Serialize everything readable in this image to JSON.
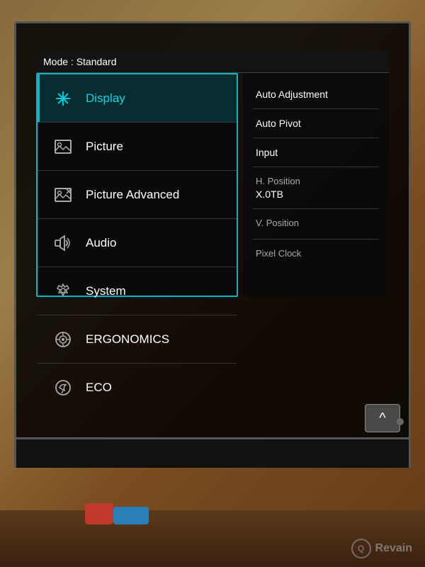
{
  "mode": {
    "label": "Mode : Standard"
  },
  "menu": {
    "items": [
      {
        "id": "display",
        "label": "Display",
        "active": true,
        "icon": "display-icon"
      },
      {
        "id": "picture",
        "label": "Picture",
        "active": false,
        "icon": "picture-icon"
      },
      {
        "id": "picture-advanced",
        "label": "Picture Advanced",
        "active": false,
        "icon": "picture-advanced-icon"
      },
      {
        "id": "audio",
        "label": "Audio",
        "active": false,
        "icon": "audio-icon"
      },
      {
        "id": "system",
        "label": "System",
        "active": false,
        "icon": "system-icon"
      },
      {
        "id": "ergonomics",
        "label": "ERGONOMICS",
        "active": false,
        "icon": "ergonomics-icon"
      },
      {
        "id": "eco",
        "label": "ECO",
        "active": false,
        "icon": "eco-icon"
      }
    ]
  },
  "content": {
    "items": [
      {
        "label": "Auto Adjustment",
        "value": ""
      },
      {
        "label": "Auto Pivot",
        "value": ""
      },
      {
        "label": "Input",
        "value": ""
      },
      {
        "label": "H. Position",
        "value": "X.0TB"
      },
      {
        "label": "V. Position",
        "value": ""
      },
      {
        "label": "Pixel Clock",
        "value": ""
      }
    ]
  },
  "scroll_button": {
    "label": "^"
  },
  "watermark": {
    "logo": "Q",
    "text": "Revain"
  }
}
